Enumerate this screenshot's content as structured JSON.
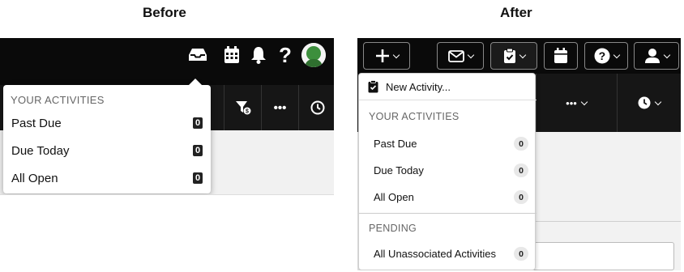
{
  "labels": {
    "before": "Before",
    "after": "After"
  },
  "before": {
    "section_label": "YOUR ACTIVITIES",
    "items": [
      {
        "label": "Past Due",
        "count": "0"
      },
      {
        "label": "Due Today",
        "count": "0"
      },
      {
        "label": "All Open",
        "count": "0"
      }
    ],
    "toolbar": {
      "more_label": "•••"
    },
    "icons": [
      "inbox-icon",
      "calendar-icon",
      "bell-icon",
      "help-icon",
      "avatar"
    ]
  },
  "after": {
    "new_activity_label": "New Activity...",
    "section_label": "YOUR ACTIVITIES",
    "items": [
      {
        "label": "Past Due",
        "count": "0"
      },
      {
        "label": "Due Today",
        "count": "0"
      },
      {
        "label": "All Open",
        "count": "0"
      }
    ],
    "pending_label": "PENDING",
    "pending_items": [
      {
        "label": "All Unassociated Activities",
        "count": "0"
      }
    ],
    "toolbar": {
      "more_label": "•••"
    },
    "icons": [
      "plus-icon",
      "mail-icon",
      "clipboard-check-icon",
      "calendar-icon",
      "help-icon",
      "user-icon"
    ]
  },
  "colors": {
    "bar": "#0a0a0a",
    "toolbar": "#161616",
    "content": "#f1f1f1",
    "badge_dark": "#222222",
    "badge_light": "#e8e8e8"
  }
}
